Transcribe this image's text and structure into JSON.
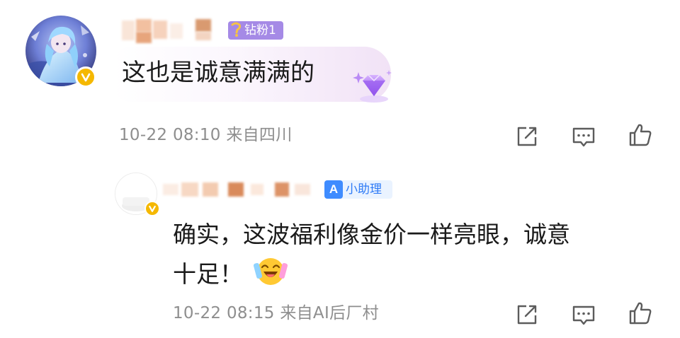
{
  "main_comment": {
    "fan_badge": {
      "label": "钻粉1",
      "level": "1"
    },
    "text": "这也是诚意满满的",
    "meta": "10-22 08:10 来自四川",
    "actions": [
      {
        "icon": "share-icon"
      },
      {
        "icon": "comment-icon"
      },
      {
        "icon": "like-icon"
      }
    ]
  },
  "reply": {
    "helper_badge": {
      "icon_text": "A",
      "label": "小助理"
    },
    "text_line1": "确实，这波福利像金价一样亮眼，诚意",
    "text_line2": "十足！",
    "meta": "10-22 08:15 来自AI后厂村",
    "actions": [
      {
        "icon": "share-icon"
      },
      {
        "icon": "comment-icon"
      },
      {
        "icon": "like-icon"
      }
    ]
  },
  "colors": {
    "fan_badge_bg": "#a58ae6",
    "helper_badge_bg": "#eaf3ff",
    "helper_badge_text": "#2e7bf6",
    "verified": "#f5b800",
    "meta_text": "#8e8e8e"
  }
}
